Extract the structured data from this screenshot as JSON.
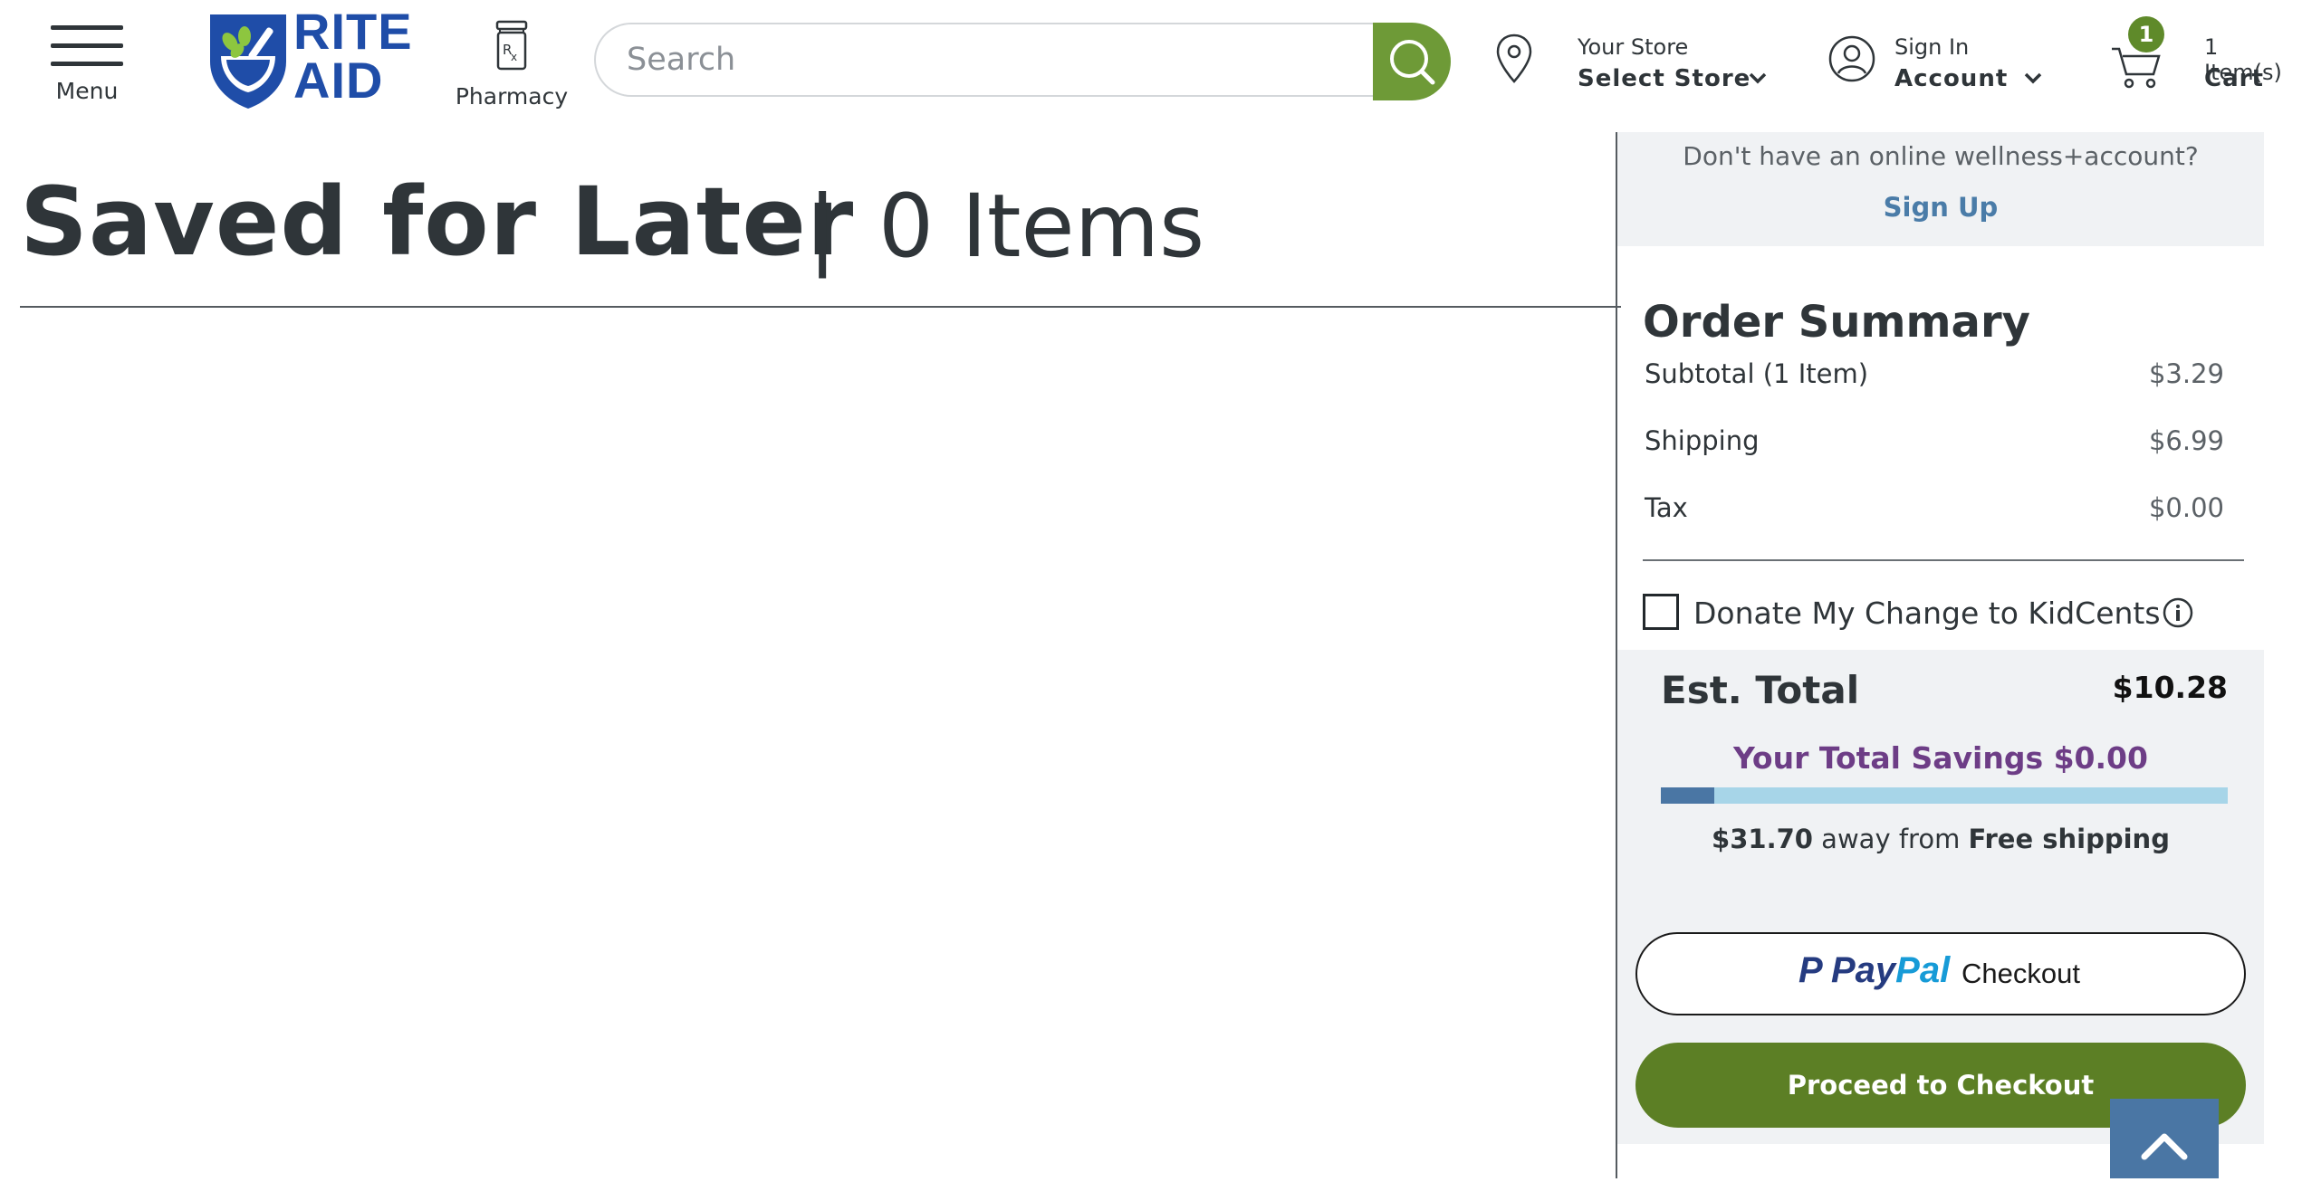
{
  "header": {
    "menu_label": "Menu",
    "logo_text_line1": "RITE",
    "logo_text_line2": "AID",
    "pharmacy_label": "Pharmacy",
    "search_placeholder": "Search",
    "store_top": "Your Store",
    "store_bottom": "Select Store",
    "account_top": "Sign In",
    "account_bottom": "Account",
    "cart_count": "1",
    "cart_top": "1 Item(s)",
    "cart_bottom": "Cart"
  },
  "main": {
    "title": "Saved for Later",
    "separator": "|",
    "item_count": "0 Items"
  },
  "sidebar": {
    "signup_prompt": "Don't have an online wellness+account?",
    "signup_link": "Sign Up",
    "summary_title": "Order Summary",
    "rows": [
      {
        "label": "Subtotal (1 Item)",
        "value": "$3.29"
      },
      {
        "label": "Shipping",
        "value": "$6.99"
      },
      {
        "label": "Tax",
        "value": "$0.00"
      }
    ],
    "donate_label": "Donate My Change to KidCents",
    "donate_checked": false,
    "est_total_label": "Est. Total",
    "est_total_value": "$10.28",
    "savings_text": "Your Total Savings $0.00",
    "free_shipping_progress": 0.094,
    "shipping_away_amount": "$31.70",
    "shipping_away_text": " away from ",
    "shipping_away_target": "Free shipping",
    "paypal_pay": "Pay",
    "paypal_pal": "Pal",
    "paypal_checkout": "Checkout",
    "checkout_label": "Proceed to Checkout"
  },
  "colors": {
    "brand_blue": "#1f4da8",
    "brand_green": "#6e9a37",
    "checkout_green": "#5c7f25",
    "savings_purple": "#6d3d86",
    "progress_fill": "#4a76a4",
    "progress_track": "#a7d5e8"
  },
  "icons": [
    "hamburger-icon",
    "rite-aid-logo",
    "pill-bottle-icon",
    "search-icon",
    "location-pin-icon",
    "user-circle-icon",
    "chevron-down-icon",
    "cart-icon",
    "info-icon",
    "paypal-logo",
    "chevron-up-icon"
  ]
}
